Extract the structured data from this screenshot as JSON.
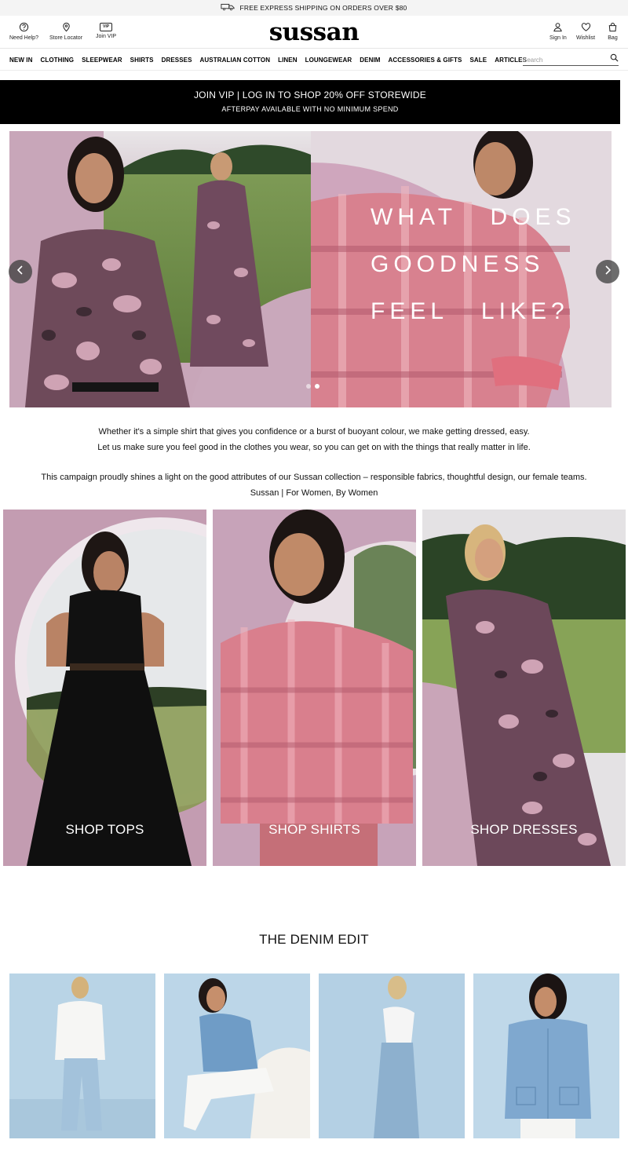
{
  "shipping_bar": {
    "text": "FREE EXPRESS SHIPPING ON ORDERS OVER $80",
    "icon": "truck-icon"
  },
  "header": {
    "logo": "sussan",
    "left_links": [
      {
        "label": "Need Help?",
        "icon": "help-icon"
      },
      {
        "label": "Store Locator",
        "icon": "location-pin-icon"
      },
      {
        "label": "Join VIP",
        "icon": "vip-icon",
        "badge": "VIP"
      }
    ],
    "right_links": [
      {
        "label": "Sign In",
        "icon": "user-icon"
      },
      {
        "label": "Wishlist",
        "icon": "heart-icon"
      },
      {
        "label": "Bag",
        "icon": "bag-icon"
      }
    ]
  },
  "nav": {
    "items": [
      "NEW IN",
      "CLOTHING",
      "SLEEPWEAR",
      "SHIRTS",
      "DRESSES",
      "AUSTRALIAN COTTON",
      "LINEN",
      "LOUNGEWEAR",
      "DENIM",
      "ACCESSORIES & GIFTS",
      "SALE",
      "ARTICLES"
    ],
    "search_placeholder": "Search"
  },
  "promo": {
    "line1": "JOIN VIP | LOG IN TO SHOP 20% OFF STOREWIDE",
    "line2": "AFTERPAY AVAILABLE WITH NO MINIMUM SPEND"
  },
  "hero": {
    "headline_lines": [
      "WHAT   DOES",
      "GOODNESS",
      "FEEL   LIKE?"
    ],
    "slide_count": 2,
    "active_slide": 2
  },
  "intro": {
    "p1_line1": "Whether it's a simple shirt that gives you confidence or a burst of buoyant colour, we make getting dressed, easy.",
    "p1_line2": "Let us make sure you feel good in the clothes you wear, so you can get on with the things that really matter in life.",
    "p2_line1": "This campaign proudly shines a light on the good attributes of our Sussan collection – responsible fabrics, thoughtful design, our female teams.",
    "p2_line2": "Sussan | For Women, By Women"
  },
  "categories": [
    {
      "label": "SHOP TOPS"
    },
    {
      "label": "SHOP SHIRTS"
    },
    {
      "label": "SHOP DRESSES"
    }
  ],
  "denim": {
    "title": "THE DENIM EDIT"
  },
  "colors": {
    "black": "#000000",
    "pink_bg": "#c9a6b6",
    "denim_bg": "#b7d3e6"
  }
}
